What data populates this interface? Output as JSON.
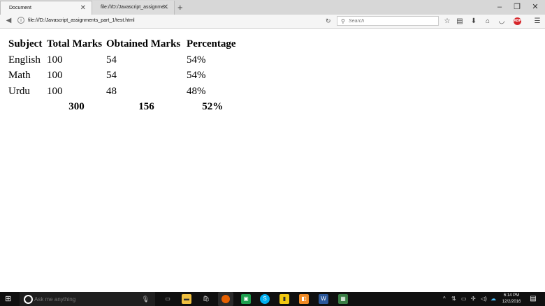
{
  "browser": {
    "tabs": [
      {
        "label": "Document",
        "close": "✕"
      },
      {
        "label": "file:///D:/Javascript_assignme...",
        "close": "✕"
      }
    ],
    "new_tab": "+",
    "window_controls": {
      "minimize": "–",
      "maximize": "❐",
      "close": "✕"
    },
    "url": "file:///D:/Javascript_assignments_part_1/test.html",
    "search_placeholder": "Search",
    "toolbar_icons": [
      "star-icon",
      "reading-list-icon",
      "download-icon",
      "home-icon",
      "pocket-icon",
      "adblock-icon",
      "menu-icon"
    ],
    "adblock_label": "ABP"
  },
  "page": {
    "headers": [
      "Subject",
      "Total Marks",
      "Obtained Marks",
      "Percentage"
    ],
    "rows": [
      [
        "English",
        "100",
        "54",
        "54%"
      ],
      [
        "Math",
        "100",
        "54",
        "54%"
      ],
      [
        "Urdu",
        "100",
        "48",
        "48%"
      ]
    ],
    "totals": [
      "300",
      "156",
      "52%"
    ]
  },
  "taskbar": {
    "search_placeholder": "Ask me anything",
    "time": "6:14 PM",
    "date": "12/2/2016",
    "colors": {
      "firefox": "#e66000",
      "skype": "#00aff0",
      "word": "#2b579a",
      "sticky": "#f2c811",
      "photos": "#1e9f4e"
    }
  }
}
